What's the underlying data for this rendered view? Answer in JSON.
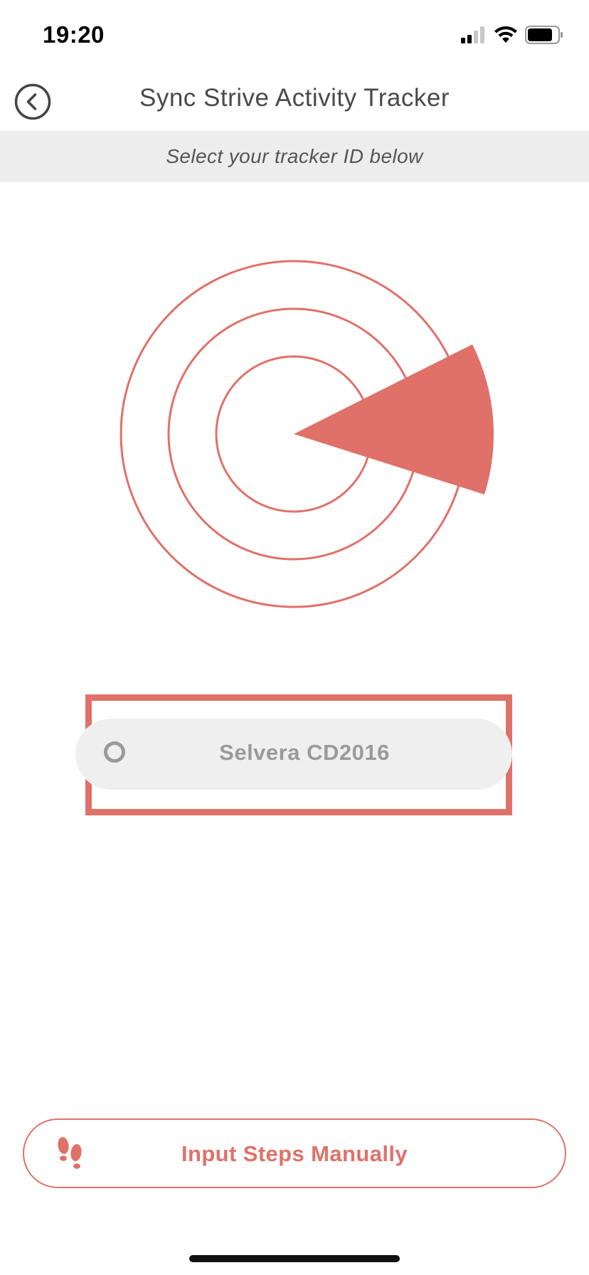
{
  "status_bar": {
    "time": "19:20",
    "icons": [
      "cellular-signal-icon",
      "wifi-icon",
      "battery-icon"
    ]
  },
  "header": {
    "back_icon": "chevron-left-icon",
    "title": "Sync Strive Activity Tracker"
  },
  "subtitle": "Select your tracker ID below",
  "radar": {
    "icon": "radar-scan-icon",
    "color": "#e07169"
  },
  "devices": [
    {
      "name": "Selvera CD2016",
      "selected": false
    }
  ],
  "manual_button": {
    "icon": "footsteps-icon",
    "label": "Input Steps Manually"
  },
  "colors": {
    "accent": "#e07169",
    "band": "#ededed",
    "pill": "#efefef",
    "muted_text": "#9a9a9a"
  }
}
